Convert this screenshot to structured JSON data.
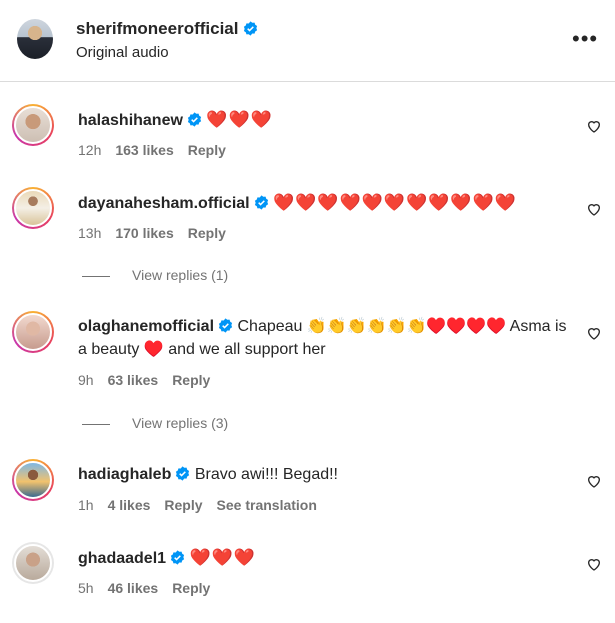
{
  "post": {
    "username": "sherifmoneerofficial",
    "subtitle": "Original audio"
  },
  "comments": [
    {
      "username": "halashihanew",
      "text": "❤️❤️❤️",
      "time": "12h",
      "likes": "163 likes",
      "reply": "Reply"
    },
    {
      "username": "dayanahesham.official",
      "text": "❤️❤️❤️❤️❤️❤️❤️❤️❤️❤️❤️",
      "time": "13h",
      "likes": "170 likes",
      "reply": "Reply",
      "view_replies": "View replies (1)"
    },
    {
      "username": "olaghanemofficial",
      "text_line1": "Chapeau 👏👏👏👏👏👏♥️♥️♥️♥️ Asma is",
      "text_line2": "a beauty ♥️ and we all support her",
      "time": "9h",
      "likes": "63 likes",
      "reply": "Reply",
      "view_replies": "View replies (3)"
    },
    {
      "username": "hadiaghaleb",
      "text": "Bravo awi!!! Begad!!",
      "time": "1h",
      "likes": "4 likes",
      "reply": "Reply",
      "translation": "See translation"
    },
    {
      "username": "ghadaadel1",
      "text": "❤️❤️❤️",
      "time": "5h",
      "likes": "46 likes",
      "reply": "Reply"
    }
  ],
  "icons": {
    "verified": "verified-badge-icon",
    "like": "heart-outline-icon",
    "more": "more-options-icon"
  },
  "colors": {
    "verified": "#0095f6",
    "meta": "#737373",
    "text": "#262626"
  }
}
